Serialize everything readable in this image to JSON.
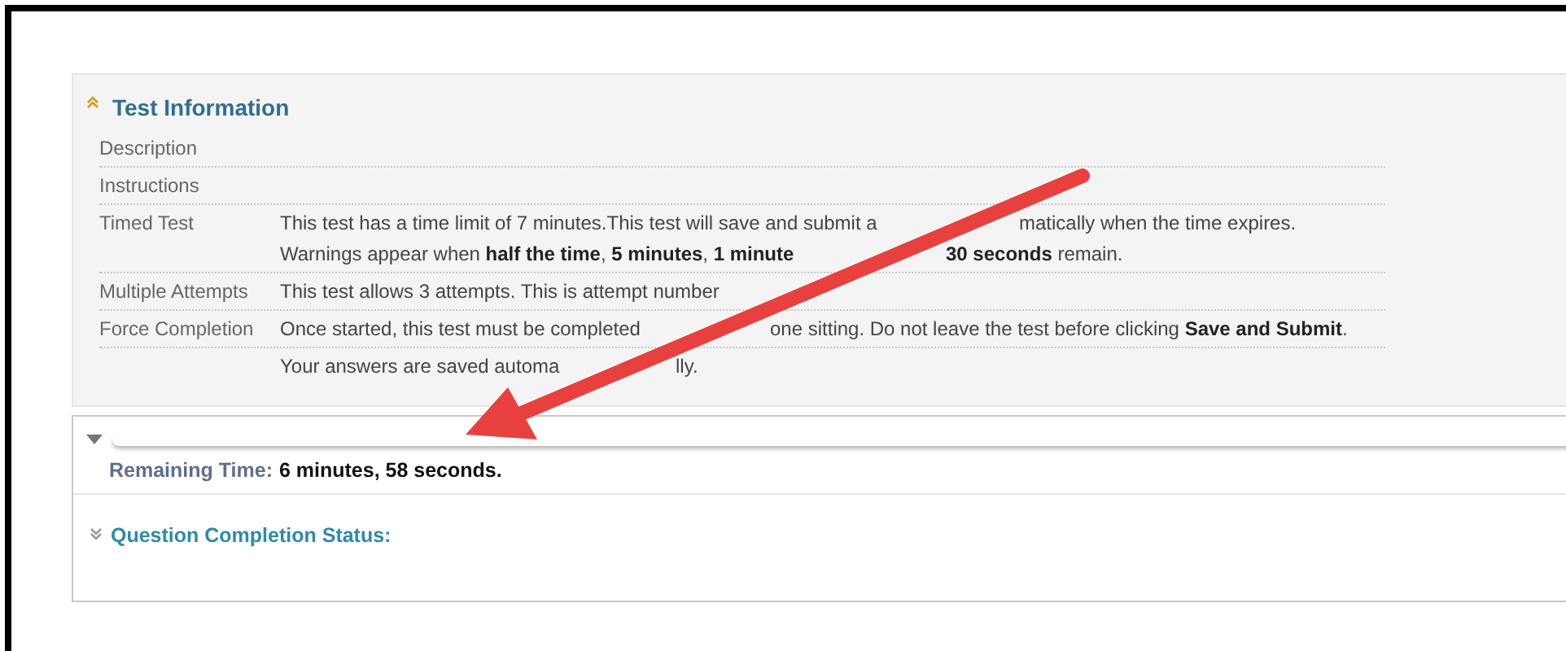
{
  "test_information": {
    "title": "Test Information",
    "expanded": true,
    "rows": [
      {
        "label": "Description",
        "lines": []
      },
      {
        "label": "Instructions",
        "lines": []
      },
      {
        "label": "Timed Test",
        "lines": [
          [
            "This test has a time limit of 7 minutes.This test will save and submit a",
            "matically when the time expires."
          ],
          [
            "Warnings appear when **half the time**, **5 minutes**, **1 minute**",
            "**30 seconds** remain."
          ]
        ]
      },
      {
        "label": "Multiple Attempts",
        "lines": [
          [
            "This test allows 3 attempts. This is attempt number"
          ]
        ]
      },
      {
        "label": "Force Completion",
        "lines": [
          [
            "Once started, this test must be completed",
            "one sitting. Do not leave the test before clicking **Save and Submit**."
          ]
        ]
      },
      {
        "label": "",
        "lines": [
          [
            "Your answers are saved automa",
            "lly."
          ]
        ]
      }
    ]
  },
  "timer": {
    "expanded": true,
    "label": "Remaining Time:",
    "value": "6 minutes, 58 seconds."
  },
  "question_status": {
    "title": "Question Completion Status:",
    "expanded": false
  }
}
